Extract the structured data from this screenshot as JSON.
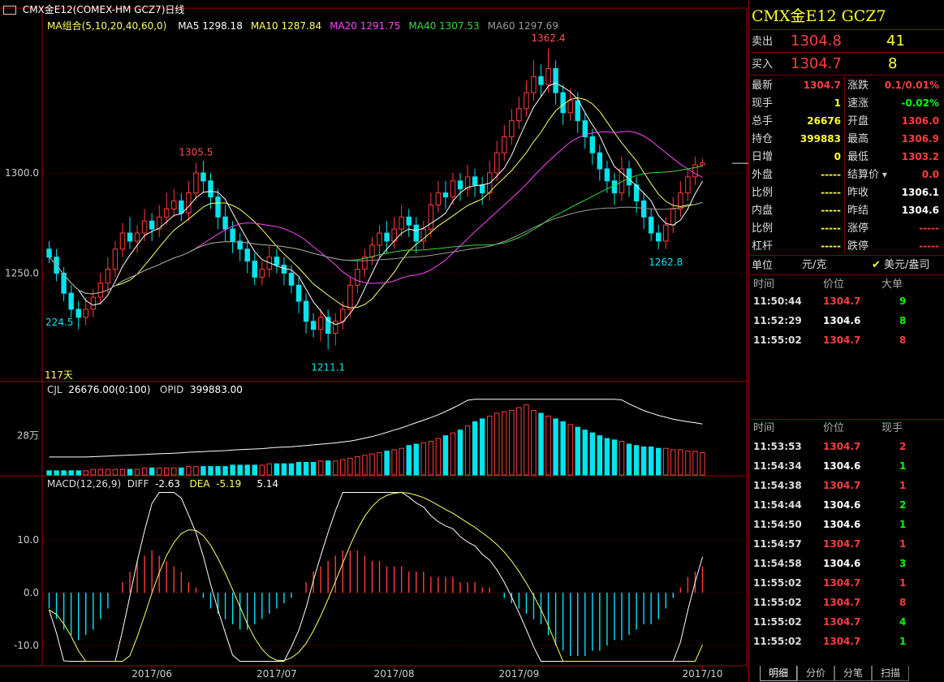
{
  "header": {
    "window_title": "CMX金E12(COMEX-HM GCZ7)日线",
    "ma_group_label": "MA组合(5,10,20,40,60,0)",
    "ma": [
      {
        "label": "MA5",
        "value": "1298.18",
        "color": "#ffffff"
      },
      {
        "label": "MA10",
        "value": "1287.84",
        "color": "#ffff66"
      },
      {
        "label": "MA20",
        "value": "1291.75",
        "color": "#ff44ff"
      },
      {
        "label": "MA40",
        "value": "1307.53",
        "color": "#33dd33"
      },
      {
        "label": "MA60",
        "value": "1297.69",
        "color": "#999999"
      }
    ],
    "days_label": "117天"
  },
  "price_axis": {
    "labels": [
      "1300.0",
      "1250.0"
    ]
  },
  "annotations": {
    "high1": "1305.5",
    "high2": "1362.4",
    "low1": "224.5",
    "low2": "1211.1",
    "low3": "1262.8"
  },
  "volume_panel": {
    "label": "CJL",
    "value": "26676.00(0:100)",
    "opid_label": "OPID",
    "opid_value": "399883.00",
    "axis_label": "28万"
  },
  "macd_panel": {
    "label": "MACD(12,26,9)",
    "diff_label": "DIFF",
    "diff_value": "-2.63",
    "dea_label": "DEA",
    "dea_value": "-5.19",
    "macd_value": "5.14",
    "axis_labels": [
      "10.0",
      "0.0",
      "-10.0"
    ]
  },
  "date_axis": [
    "2017/06",
    "2017/07",
    "2017/08",
    "2017/09",
    "2017/10"
  ],
  "chart_data": {
    "type": "candlestick",
    "price_ylim": [
      1200,
      1370
    ],
    "candles": [
      [
        1262,
        1258,
        1266,
        1255
      ],
      [
        1258,
        1250,
        1262,
        1246
      ],
      [
        1250,
        1240,
        1253,
        1236
      ],
      [
        1240,
        1232,
        1244,
        1228
      ],
      [
        1232,
        1228,
        1236,
        1222
      ],
      [
        1228,
        1232,
        1238,
        1224
      ],
      [
        1232,
        1238,
        1242,
        1228
      ],
      [
        1238,
        1245,
        1250,
        1234
      ],
      [
        1245,
        1252,
        1258,
        1240
      ],
      [
        1252,
        1262,
        1266,
        1248
      ],
      [
        1262,
        1270,
        1275,
        1258
      ],
      [
        1270,
        1266,
        1278,
        1262
      ],
      [
        1266,
        1270,
        1274,
        1260
      ],
      [
        1270,
        1276,
        1282,
        1266
      ],
      [
        1276,
        1272,
        1280,
        1266
      ],
      [
        1272,
        1278,
        1284,
        1268
      ],
      [
        1278,
        1282,
        1290,
        1274
      ],
      [
        1282,
        1286,
        1292,
        1278
      ],
      [
        1286,
        1280,
        1290,
        1276
      ],
      [
        1280,
        1290,
        1296,
        1276
      ],
      [
        1290,
        1300,
        1305,
        1286
      ],
      [
        1300,
        1296,
        1306,
        1290
      ],
      [
        1296,
        1288,
        1300,
        1282
      ],
      [
        1288,
        1278,
        1292,
        1272
      ],
      [
        1278,
        1272,
        1284,
        1266
      ],
      [
        1272,
        1266,
        1276,
        1260
      ],
      [
        1266,
        1262,
        1270,
        1256
      ],
      [
        1262,
        1256,
        1266,
        1250
      ],
      [
        1256,
        1248,
        1260,
        1244
      ],
      [
        1248,
        1252,
        1256,
        1244
      ],
      [
        1252,
        1258,
        1264,
        1248
      ],
      [
        1258,
        1254,
        1262,
        1250
      ],
      [
        1254,
        1250,
        1258,
        1244
      ],
      [
        1250,
        1244,
        1254,
        1240
      ],
      [
        1244,
        1236,
        1248,
        1230
      ],
      [
        1236,
        1226,
        1240,
        1220
      ],
      [
        1226,
        1222,
        1230,
        1218
      ],
      [
        1222,
        1228,
        1232,
        1216
      ],
      [
        1228,
        1220,
        1232,
        1212
      ],
      [
        1220,
        1226,
        1230,
        1214
      ],
      [
        1226,
        1232,
        1236,
        1222
      ],
      [
        1232,
        1244,
        1248,
        1228
      ],
      [
        1244,
        1252,
        1256,
        1240
      ],
      [
        1252,
        1258,
        1262,
        1248
      ],
      [
        1258,
        1264,
        1268,
        1254
      ],
      [
        1264,
        1270,
        1274,
        1258
      ],
      [
        1270,
        1266,
        1276,
        1260
      ],
      [
        1266,
        1272,
        1278,
        1262
      ],
      [
        1272,
        1278,
        1284,
        1268
      ],
      [
        1278,
        1274,
        1282,
        1268
      ],
      [
        1274,
        1266,
        1278,
        1260
      ],
      [
        1266,
        1272,
        1276,
        1262
      ],
      [
        1272,
        1284,
        1290,
        1268
      ],
      [
        1284,
        1290,
        1296,
        1280
      ],
      [
        1290,
        1288,
        1296,
        1282
      ],
      [
        1288,
        1296,
        1300,
        1284
      ],
      [
        1296,
        1292,
        1300,
        1286
      ],
      [
        1292,
        1298,
        1304,
        1288
      ],
      [
        1298,
        1294,
        1302,
        1288
      ],
      [
        1294,
        1290,
        1298,
        1284
      ],
      [
        1290,
        1300,
        1306,
        1286
      ],
      [
        1300,
        1310,
        1316,
        1296
      ],
      [
        1310,
        1318,
        1324,
        1306
      ],
      [
        1318,
        1326,
        1332,
        1314
      ],
      [
        1326,
        1332,
        1338,
        1322
      ],
      [
        1332,
        1340,
        1346,
        1328
      ],
      [
        1340,
        1348,
        1356,
        1336
      ],
      [
        1348,
        1344,
        1354,
        1338
      ],
      [
        1344,
        1352,
        1362,
        1340
      ],
      [
        1352,
        1340,
        1356,
        1334
      ],
      [
        1340,
        1330,
        1344,
        1324
      ],
      [
        1330,
        1336,
        1342,
        1326
      ],
      [
        1336,
        1326,
        1340,
        1320
      ],
      [
        1326,
        1318,
        1330,
        1312
      ],
      [
        1318,
        1310,
        1322,
        1304
      ],
      [
        1310,
        1302,
        1314,
        1296
      ],
      [
        1302,
        1296,
        1306,
        1290
      ],
      [
        1296,
        1290,
        1300,
        1284
      ],
      [
        1290,
        1302,
        1308,
        1286
      ],
      [
        1302,
        1294,
        1306,
        1288
      ],
      [
        1294,
        1286,
        1298,
        1280
      ],
      [
        1286,
        1278,
        1290,
        1272
      ],
      [
        1278,
        1270,
        1282,
        1266
      ],
      [
        1270,
        1266,
        1274,
        1262
      ],
      [
        1266,
        1274,
        1278,
        1262
      ],
      [
        1274,
        1282,
        1288,
        1270
      ],
      [
        1282,
        1290,
        1296,
        1278
      ],
      [
        1290,
        1298,
        1302,
        1286
      ],
      [
        1298,
        1304,
        1308,
        1294
      ],
      [
        1304,
        1305,
        1307,
        1303
      ]
    ],
    "volume": [
      3,
      3,
      3,
      3,
      3,
      3,
      4,
      4,
      4,
      4,
      4,
      4,
      4,
      5,
      5,
      5,
      5,
      5,
      5,
      6,
      6,
      6,
      6,
      6,
      6,
      7,
      7,
      7,
      7,
      7,
      8,
      8,
      8,
      8,
      9,
      9,
      9,
      10,
      10,
      10,
      11,
      12,
      13,
      14,
      15,
      16,
      17,
      18,
      19,
      21,
      22,
      23,
      24,
      26,
      28,
      30,
      32,
      35,
      38,
      40,
      42,
      44,
      45,
      46,
      48,
      50,
      46,
      44,
      42,
      40,
      38,
      36,
      34,
      32,
      30,
      28,
      26,
      25,
      24,
      22,
      21,
      20,
      20,
      19,
      19,
      18,
      18,
      17,
      17,
      16
    ],
    "macd": [
      -3,
      -5,
      -7,
      -8,
      -9,
      -8,
      -7,
      -5,
      -3,
      0,
      2,
      4,
      6,
      7,
      8,
      7,
      6,
      5,
      4,
      2,
      1,
      -1,
      -3,
      -4,
      -5,
      -6,
      -7,
      -7,
      -6,
      -5,
      -4,
      -3,
      -2,
      -1,
      0,
      2,
      4,
      5,
      6,
      7,
      8,
      8,
      8,
      7,
      6,
      6,
      5,
      5,
      5,
      4,
      4,
      4,
      3,
      3,
      3,
      3,
      2,
      2,
      2,
      1,
      1,
      0,
      -1,
      -2,
      -3,
      -4,
      -5,
      -6,
      -8,
      -10,
      -11,
      -12,
      -12,
      -12,
      -11,
      -11,
      -10,
      -9,
      -9,
      -8,
      -7,
      -6,
      -6,
      -5,
      -3,
      -1,
      1,
      3,
      4,
      5
    ]
  },
  "sidebar": {
    "title": "CMX金E12  GCZ7",
    "ask_label": "卖出",
    "ask_price": "1304.8",
    "ask_qty": "41",
    "bid_label": "买入",
    "bid_price": "1304.7",
    "bid_qty": "8",
    "quote_left": [
      {
        "label": "最新",
        "value": "1304.7",
        "cls": "red"
      },
      {
        "label": "现手",
        "value": "1",
        "cls": "yel"
      },
      {
        "label": "总手",
        "value": "26676",
        "cls": "yel"
      },
      {
        "label": "持仓",
        "value": "399883",
        "cls": "yel"
      },
      {
        "label": "日增",
        "value": "0",
        "cls": "yel"
      },
      {
        "label": "外盘",
        "value": "-----",
        "cls": "yel"
      },
      {
        "label": "比例",
        "value": "-----",
        "cls": "yel"
      },
      {
        "label": "内盘",
        "value": "-----",
        "cls": "yel"
      },
      {
        "label": "比例",
        "value": "-----",
        "cls": "yel"
      },
      {
        "label": "杠杆",
        "value": "-----",
        "cls": "yel"
      }
    ],
    "quote_right": [
      {
        "label": "涨跌",
        "value": "0.1/0.01%",
        "cls": "red"
      },
      {
        "label": "速涨",
        "value": "-0.02%",
        "cls": "grn"
      },
      {
        "label": "开盘",
        "value": "1306.0",
        "cls": "red"
      },
      {
        "label": "最高",
        "value": "1306.9",
        "cls": "red"
      },
      {
        "label": "最低",
        "value": "1303.2",
        "cls": "red"
      },
      {
        "label": "结算价",
        "value": "0.0",
        "cls": "red"
      },
      {
        "label": "昨收",
        "value": "1306.1",
        "cls": "wht"
      },
      {
        "label": "昨结",
        "value": "1304.6",
        "cls": "wht"
      },
      {
        "label": "涨停",
        "value": "-----",
        "cls": "red"
      },
      {
        "label": "跌停",
        "value": "-----",
        "cls": "red"
      }
    ],
    "unit_label": "单位",
    "unit_value": "元/克",
    "currency_label": "美元/盎司",
    "ticks_headers": [
      "时间",
      "价位",
      "大单"
    ],
    "big_ticks": [
      {
        "time": "11:50:44",
        "price": "1304.7",
        "pc": "red",
        "qty": "9",
        "qc": "grn"
      },
      {
        "time": "11:52:29",
        "price": "1304.6",
        "pc": "wht",
        "qty": "8",
        "qc": "grn"
      },
      {
        "time": "11:55:02",
        "price": "1304.7",
        "pc": "red",
        "qty": "8",
        "qc": "red"
      }
    ],
    "trades_headers": [
      "时间",
      "价位",
      "现手"
    ],
    "trades": [
      {
        "time": "11:53:53",
        "price": "1304.7",
        "pc": "red",
        "qty": "2",
        "qc": "red"
      },
      {
        "time": "11:54:34",
        "price": "1304.6",
        "pc": "wht",
        "qty": "1",
        "qc": "grn"
      },
      {
        "time": "11:54:38",
        "price": "1304.7",
        "pc": "red",
        "qty": "1",
        "qc": "red"
      },
      {
        "time": "11:54:44",
        "price": "1304.6",
        "pc": "wht",
        "qty": "2",
        "qc": "grn"
      },
      {
        "time": "11:54:50",
        "price": "1304.6",
        "pc": "wht",
        "qty": "1",
        "qc": "grn"
      },
      {
        "time": "11:54:57",
        "price": "1304.7",
        "pc": "red",
        "qty": "1",
        "qc": "red"
      },
      {
        "time": "11:54:58",
        "price": "1304.6",
        "pc": "wht",
        "qty": "3",
        "qc": "grn"
      },
      {
        "time": "11:55:02",
        "price": "1304.7",
        "pc": "red",
        "qty": "1",
        "qc": "red"
      },
      {
        "time": "11:55:02",
        "price": "1304.7",
        "pc": "red",
        "qty": "8",
        "qc": "red"
      },
      {
        "time": "11:55:02",
        "price": "1304.7",
        "pc": "red",
        "qty": "4",
        "qc": "grn"
      },
      {
        "time": "11:55:02",
        "price": "1304.7",
        "pc": "red",
        "qty": "1",
        "qc": "grn"
      }
    ],
    "tabs": [
      "明细",
      "分价",
      "分笔",
      "扫描"
    ]
  }
}
